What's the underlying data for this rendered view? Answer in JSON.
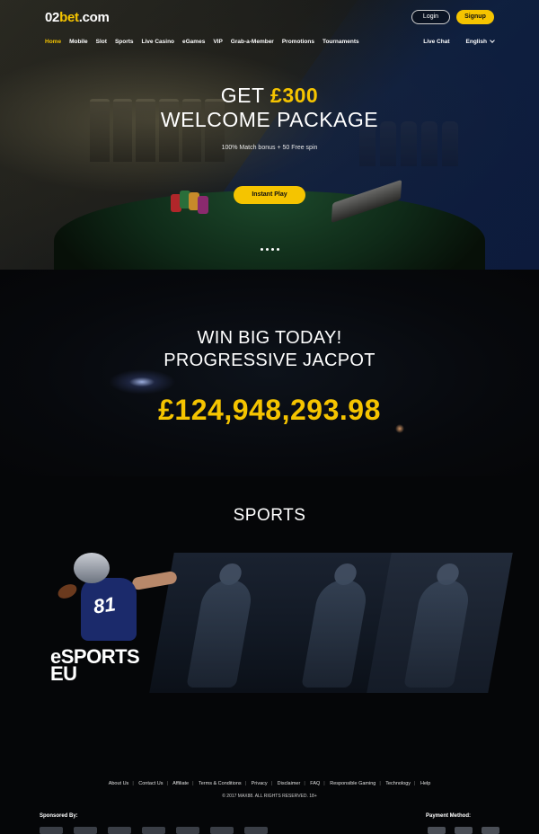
{
  "brand": {
    "logo_part1": "02",
    "logo_part2": "bet",
    "logo_part3": ".com"
  },
  "header": {
    "login_label": "Login",
    "signup_label": "Signup",
    "nav": [
      "Home",
      "Mobile",
      "Slot",
      "Sports",
      "Live Casino",
      "eGames",
      "VIP",
      "Grab-a-Member",
      "Promotions",
      "Tournaments"
    ],
    "active_nav": "Home",
    "live_chat": "Live Chat",
    "language": "English"
  },
  "hero": {
    "title_prefix": "GET ",
    "title_amount": "£300",
    "title_line2": "WELCOME PACKAGE",
    "subtitle": "100% Match bonus + 50 Free spin",
    "cta_label": "Instant Play",
    "slide_count": 4
  },
  "jackpot": {
    "line1": "WIN BIG TODAY!",
    "line2": "PROGRESSIVE JACPOT",
    "amount": "£124,948,293.98"
  },
  "sports": {
    "title": "SPORTS",
    "esports_line1": "eSPORTS",
    "esports_line2": "EU",
    "jersey_number": "81"
  },
  "footer": {
    "links": [
      "About Us",
      "Contact Us",
      "Affiliate",
      "Terms & Conditions",
      "Privacy",
      "Disclaimer",
      "FAQ",
      "Responsible Gaming",
      "Technology",
      "Help"
    ],
    "copyright": "© 2017 MAX88. ALL RIGHTS RESERVED. 18+",
    "sponsored_label": "Sponsored By:",
    "payment_label": "Payment Method:"
  },
  "colors": {
    "accent": "#f5c400",
    "background": "#050608"
  }
}
